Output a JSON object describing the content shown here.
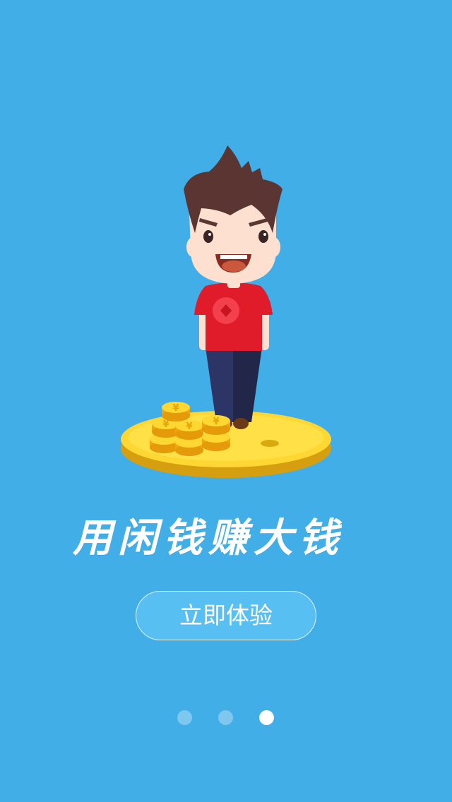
{
  "onboarding": {
    "slogan": "用闲钱赚大钱",
    "cta_label": "立即体验",
    "page_indicator": {
      "total": 3,
      "current": 3
    }
  },
  "colors": {
    "background": "#42aee8",
    "button_fill": "#58bff3",
    "coin_gold": "#ffd733",
    "shirt_red": "#e01b2a"
  },
  "icons": {
    "illustration": "man-with-coins-illustration",
    "coin_symbol": "¥"
  }
}
